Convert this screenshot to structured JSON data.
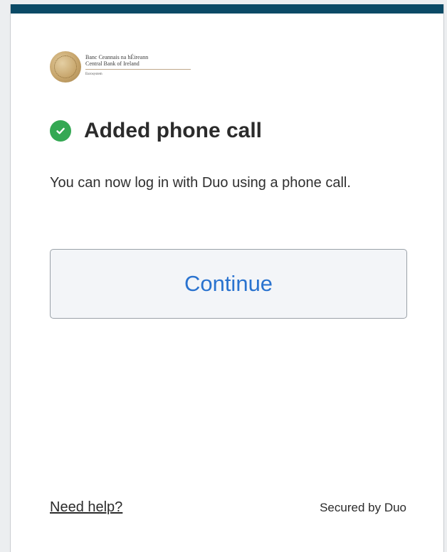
{
  "logo": {
    "line1": "Banc Ceannais na hÉireann",
    "line2": "Central Bank of Ireland",
    "line3": "Eurosystem"
  },
  "status": {
    "icon": "check-circle-icon",
    "title": "Added phone call"
  },
  "message": "You can now log in with Duo using a phone call.",
  "actions": {
    "continue_label": "Continue"
  },
  "footer": {
    "help_label": "Need help?",
    "secured_label": "Secured by Duo"
  },
  "colors": {
    "top_bar": "#0b4a66",
    "success": "#34a853",
    "button_text": "#2a73cf"
  }
}
